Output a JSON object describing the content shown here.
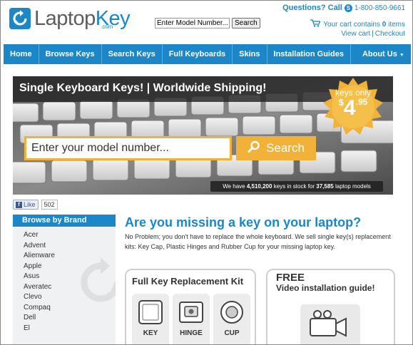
{
  "brand": {
    "name_part1": "Laptop",
    "name_part2": "Key",
    "domain": ".com"
  },
  "header": {
    "search": {
      "value": "Enter Model Number...",
      "button_label": "Search"
    },
    "questions_label": "Questions? Call",
    "phone": "1-800-850-9661",
    "cart": {
      "prefix": "Your cart contains",
      "count": "0",
      "suffix": "items"
    },
    "links": [
      "View cart",
      "Checkout"
    ]
  },
  "nav": {
    "items": [
      "Home",
      "Browse Keys",
      "Search Keys",
      "Full Keyboards",
      "Skins",
      "Installation Guides"
    ],
    "about": "About Us"
  },
  "banner": {
    "title": "Single Keyboard Keys! | Worldwide Shipping!",
    "input_placeholder": "Enter your model number...",
    "search_label": "Search",
    "stock": {
      "prefix": "We have",
      "keys": "4,510,200",
      "middle": "keys in stock for",
      "models": "37,585",
      "suffix": "laptop models"
    },
    "badge": {
      "line1": "keys only",
      "dollar": "$",
      "price": "4",
      "cents": ".95"
    }
  },
  "like": {
    "label": "Like",
    "count": "502"
  },
  "sidebar": {
    "title": "Browse by Brand",
    "brands": [
      "Acer",
      "Advent",
      "Alienware",
      "Apple",
      "Asus",
      "Averatec",
      "Clevo",
      "Compaq",
      "Dell",
      "El"
    ]
  },
  "main": {
    "heading": "Are you missing a key on your laptop?",
    "description": "No Problem; you don't have to replace the whole keyboard. We sell single key(s) replacement kits: Key Cap, Plastic Hinges and Rubber Cup for your missing laptop key."
  },
  "kit": {
    "title": "Full Key Replacement Kit",
    "parts": [
      "KEY",
      "HINGE",
      "CUP"
    ]
  },
  "video": {
    "free": "FREE",
    "subtitle": "Video installation guide!"
  },
  "colors": {
    "brand_blue": "#1b87c9",
    "accent_orange": "#f2b23a"
  }
}
